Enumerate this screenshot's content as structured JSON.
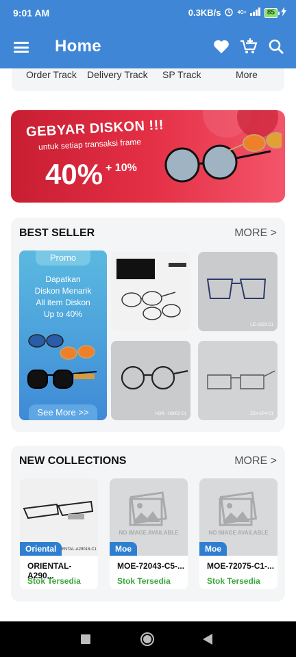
{
  "status": {
    "time": "9:01 AM",
    "speed": "0.3KB/s",
    "network": "4G+",
    "battery": "85"
  },
  "appbar": {
    "title": "Home",
    "icons": [
      "menu-icon",
      "heart-icon",
      "cart-add-icon",
      "search-icon"
    ]
  },
  "quick_links": [
    "Order Track",
    "Delivery Track",
    "SP Track",
    "More"
  ],
  "banner": {
    "line1": "GEBYAR DISKON !!!",
    "line2": "untuk setiap transaksi frame",
    "big": "40%",
    "extra": "+ 10%"
  },
  "best_seller": {
    "title": "BEST SELLER",
    "more": "MORE >",
    "promo": {
      "tag": "Promo",
      "text": [
        "Dapatkan",
        "Diskon Menarik",
        "All item Diskon",
        "Up to 40%"
      ],
      "button": "See More >>"
    },
    "tiles": [
      {
        "code": "LEI-2323 C1"
      },
      {
        "code": "HOR - H3002 C1"
      },
      {
        "code": "ZEN-1P4 C1"
      }
    ]
  },
  "new_collections": {
    "title": "NEW COLLECTIONS",
    "more": "MORE >",
    "items": [
      {
        "badge": "Oriental",
        "name": "ORIENTAL-A290...",
        "stock": "Stok Tersedia",
        "img_code": "ORIENTAL-A29018-C1",
        "no_image": ""
      },
      {
        "badge": "Moe",
        "name": "MOE-72043-C5-...",
        "stock": "Stok Tersedia",
        "img_code": "",
        "no_image": "NO IMAGE AVAILABLE"
      },
      {
        "badge": "Moe",
        "name": "MOE-72075-C1-...",
        "stock": "Stok Tersedia",
        "img_code": "",
        "no_image": "NO IMAGE AVAILABLE"
      }
    ]
  },
  "colors": {
    "primary": "#3f86d6",
    "banner_red": "#e42f45",
    "stock_green": "#3aa63a",
    "badge_blue": "#2f7fd1"
  }
}
